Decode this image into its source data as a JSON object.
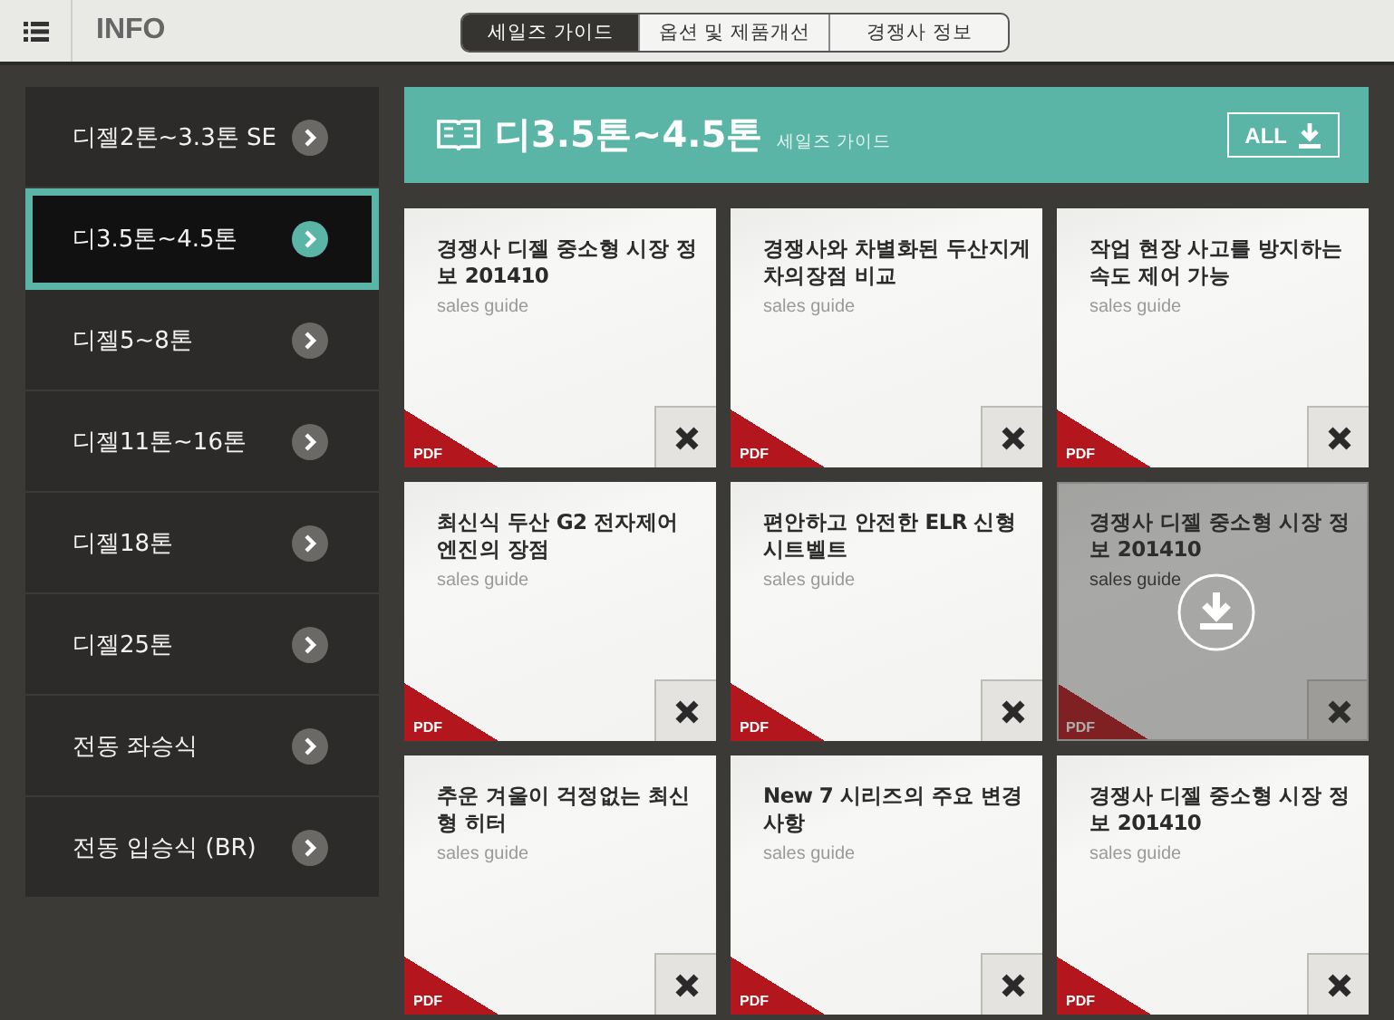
{
  "top_bar": {
    "title": "INFO",
    "tabs": [
      {
        "label": "세일즈 가이드",
        "selected": true
      },
      {
        "label": "옵션 및 제품개선",
        "selected": false
      },
      {
        "label": "경쟁사 정보",
        "selected": false
      }
    ]
  },
  "sidebar": {
    "items": [
      {
        "label": "디젤2톤~3.3톤 SE",
        "selected": false
      },
      {
        "label": "디3.5톤~4.5톤",
        "selected": true
      },
      {
        "label": "디젤5~8톤",
        "selected": false
      },
      {
        "label": "디젤11톤~16톤",
        "selected": false
      },
      {
        "label": "디젤18톤",
        "selected": false
      },
      {
        "label": "디젤25톤",
        "selected": false
      },
      {
        "label": "전동 좌승식",
        "selected": false
      },
      {
        "label": "전동 입승식 (BR)",
        "selected": false
      }
    ]
  },
  "header": {
    "title": "디3.5톤~4.5톤",
    "subtitle": "세일즈 가이드",
    "all_button": "ALL"
  },
  "cards": [
    {
      "title": "경쟁사 디젤 중소형 시장 정보 201410",
      "subtitle": "sales guide",
      "badge": "PDF",
      "overlay": false
    },
    {
      "title": "경쟁사와 차별화된 두산지게차의장점 비교",
      "subtitle": "sales guide",
      "badge": "PDF",
      "overlay": false
    },
    {
      "title": "작업 현장 사고를 방지하는 속도 제어 가능",
      "subtitle": "sales guide",
      "badge": "PDF",
      "overlay": false
    },
    {
      "title": "최신식 두산 G2 전자제어 엔진의 장점",
      "subtitle": "sales guide",
      "badge": "PDF",
      "overlay": false
    },
    {
      "title": "편안하고 안전한 ELR 신형 시트벨트",
      "subtitle": "sales guide",
      "badge": "PDF",
      "overlay": false
    },
    {
      "title": "경쟁사 디젤 중소형 시장 정보 201410",
      "subtitle": "sales guide",
      "badge": "PDF",
      "overlay": true
    },
    {
      "title": "추운 겨울이 걱정없는 최신형 히터",
      "subtitle": "sales guide",
      "badge": "PDF",
      "overlay": false
    },
    {
      "title": "New 7 시리즈의 주요 변경 사항",
      "subtitle": "sales guide",
      "badge": "PDF",
      "overlay": false
    },
    {
      "title": "경쟁사 디젤 중소형 시장 정보 201410",
      "subtitle": "sales guide",
      "badge": "PDF",
      "overlay": false
    }
  ]
}
